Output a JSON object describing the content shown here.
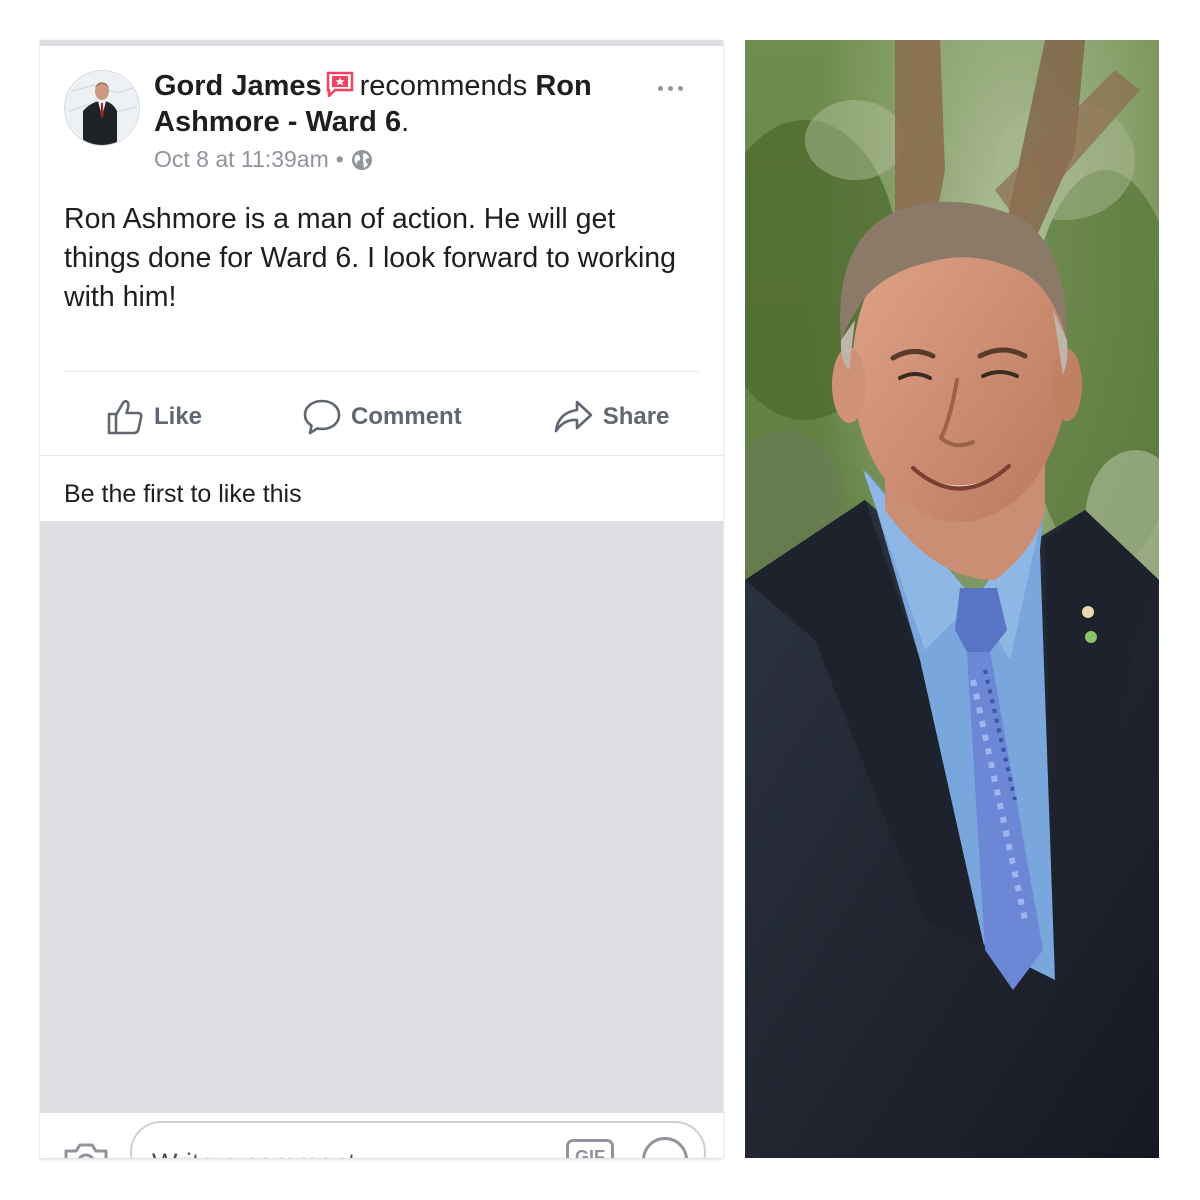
{
  "post": {
    "author": "Gord James",
    "recommends_text": "recommends",
    "page_name_line1": "Ron",
    "page_name_line2": "Ashmore - Ward 6",
    "end_punct": ".",
    "timestamp": "Oct 8 at 11:39am",
    "separator": "•",
    "privacy_icon": "globe-icon",
    "body": "Ron Ashmore is a man of action. He will get things done for Ward 6. I look forward to working with him!",
    "likes_summary": "Be the first to like this"
  },
  "actions": {
    "like_label": "Like",
    "comment_label": "Comment",
    "share_label": "Share"
  },
  "comment_bar": {
    "placeholder": "Write a comment...",
    "gif_label": "GIF"
  },
  "colors": {
    "text": "#1c1e21",
    "secondary": "#90949c",
    "action_gray": "#606770",
    "recommend_red": "#f3425f",
    "comments_bg": "#dfe0e4"
  }
}
